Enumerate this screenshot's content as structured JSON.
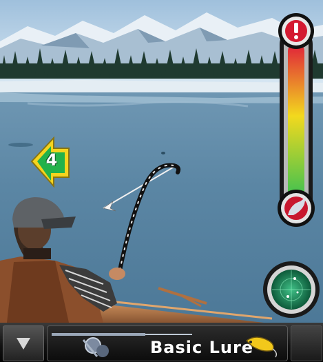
{
  "game": {
    "title_text": "",
    "level_number": "4",
    "tension_gauge": {
      "warning_icon": "exclamation-icon",
      "fish_icon": "fish-icon",
      "colors": [
        "#e0223a",
        "#f2d91e",
        "#2fbf55"
      ]
    },
    "sonar": {
      "icon": "sonar-radar-icon",
      "color": "#1f8a5a"
    }
  },
  "toolbar": {
    "menu_icon": "triangle-down-icon",
    "lure_label": "Basic Lure",
    "rod_icon": "fishing-reel-icon",
    "lure_icon": "lure-icon"
  }
}
